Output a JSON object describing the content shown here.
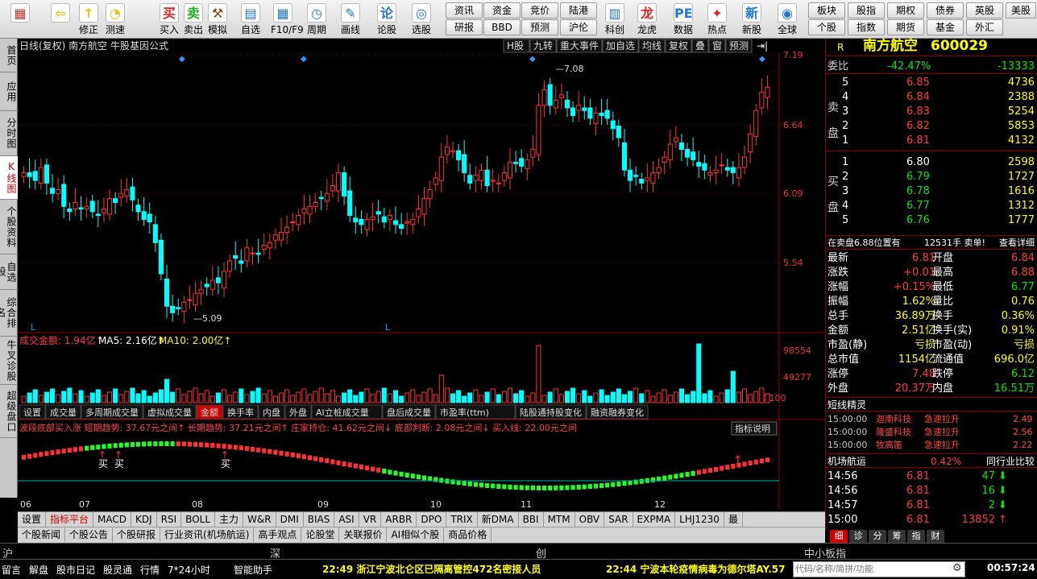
{
  "toolbar": {
    "items": [
      {
        "label": "",
        "icon": "windows-logo-icon"
      },
      {
        "label": "",
        "icon": "back-arrow-icon"
      },
      {
        "label": "修正",
        "icon": "up-arrow-icon"
      },
      {
        "label": "测速",
        "icon": "clock-icon"
      },
      {
        "label": "买入",
        "icon": "buy-icon"
      },
      {
        "label": "卖出",
        "icon": "sell-icon"
      },
      {
        "label": "模拟",
        "icon": "hammer-icon"
      },
      {
        "label": "自选",
        "icon": "watchlist-icon"
      },
      {
        "label": "F10/F9",
        "icon": "f10-icon"
      },
      {
        "label": "周期",
        "icon": "cycle-icon"
      },
      {
        "label": "画线",
        "icon": "pencil-icon"
      },
      {
        "label": "论股",
        "icon": "discuss-icon"
      },
      {
        "label": "选股",
        "icon": "picker-icon"
      },
      {
        "label": "科创",
        "icon": "kechuang-icon"
      },
      {
        "label": "龙虎",
        "icon": "dragon-icon"
      },
      {
        "label": "数据",
        "icon": "pe-icon"
      },
      {
        "label": "热点",
        "icon": "hot-icon"
      },
      {
        "label": "新股",
        "icon": "ipo-icon"
      },
      {
        "label": "全球",
        "icon": "globe-icon"
      }
    ],
    "nav": [
      [
        "资讯",
        "研报"
      ],
      [
        "资金",
        "BBD"
      ],
      [
        "竞价",
        "预测"
      ],
      [
        "陆港",
        "沪伦"
      ]
    ],
    "nav2": [
      [
        "板块",
        "个股"
      ],
      [
        "股指",
        "指数"
      ],
      [
        "期权",
        "期货"
      ],
      [
        "债券",
        "基金"
      ],
      [
        "英股",
        "外汇"
      ],
      [
        "美股",
        ""
      ]
    ]
  },
  "leftnav": [
    "首页",
    "应用",
    "分时图",
    "K线图",
    "个股资料",
    "自选股",
    "综合排名",
    "牛叉诊股",
    "超级盘口"
  ],
  "chart": {
    "header": "日线(复权)  南方航空 牛股基因公式",
    "tabs": [
      "H股",
      "九转",
      "重大事件",
      "加自选",
      "均线",
      "复权",
      "叠",
      "窗",
      "预测"
    ],
    "price_axis": [
      "7.19",
      "6.64",
      "6.09",
      "5.54"
    ],
    "max_label": "7.08",
    "min_label": "5.09",
    "vol_title": "成交金额: 1.94亿↑",
    "vol_ma5": "MA5: 2.16亿↑",
    "vol_ma10": "MA10: 2.00亿↑",
    "vol_axis": [
      "98554",
      "49277",
      "X100"
    ],
    "subtabs": [
      "设置",
      "成交量",
      "多周期成交量",
      "虚拟成交量",
      "金额",
      "换手率",
      "内盘",
      "外盘",
      "AI立桩成交量",
      "盘后成交量",
      "市盈率(ttm)",
      "陆股通持股变化",
      "融资融券变化"
    ],
    "ind_line": "波段底部买入涨 短期趋势: 37.67元之间↑ 长期趋势: 37.21元之间↑ 庄家持仓: 41.62元之间↓ 底部判断: 2.08元之间↓ 买入线: 22.00元之间",
    "ind_btn": "指标说明",
    "buy_label": "买",
    "months": [
      "06",
      "07",
      "08",
      "09",
      "10",
      "11",
      "12"
    ]
  },
  "botbar1": [
    "设置",
    "指标平台",
    "MACD",
    "KDJ",
    "RSI",
    "BOLL",
    "主力",
    "W&R",
    "DMI",
    "BIAS",
    "ASI",
    "VR",
    "ARBR",
    "DPO",
    "TRIX",
    "新DMA",
    "BBI",
    "MTM",
    "OBV",
    "SAR",
    "EXPMA",
    "LHJ1230",
    "最"
  ],
  "botbar2": [
    "个股新闻",
    "个股公告",
    "个股研报",
    "行业资讯(机场航运)",
    "高手观点",
    "论股堂",
    "关联报价",
    "AI相似个股",
    "商品价格"
  ],
  "quote": {
    "name": "南方航空",
    "code": "600029",
    "weibi_label": "委比",
    "weibi": "-42.47%",
    "weicha": "-13333",
    "sell": [
      [
        "5",
        "6.85",
        "4736"
      ],
      [
        "4",
        "6.84",
        "2388"
      ],
      [
        "3",
        "6.83",
        "5254"
      ],
      [
        "2",
        "6.82",
        "5853"
      ],
      [
        "1",
        "6.81",
        "4132"
      ]
    ],
    "buy": [
      [
        "1",
        "6.80",
        "2598"
      ],
      [
        "2",
        "6.79",
        "1727"
      ],
      [
        "3",
        "6.78",
        "1616"
      ],
      [
        "4",
        "6.77",
        "1312"
      ],
      [
        "5",
        "6.76",
        "1777"
      ]
    ],
    "note": "在卖盘6.88位置有",
    "note_vol": "12531手 卖单!",
    "note_link": "查看详细",
    "stats": [
      [
        "最新",
        "6.81",
        "开盘",
        "6.84"
      ],
      [
        "涨跌",
        "+0.01",
        "最高",
        "6.88"
      ],
      [
        "涨幅",
        "+0.15%",
        "最低",
        "6.77"
      ],
      [
        "振幅",
        "1.62%",
        "量比",
        "0.76"
      ],
      [
        "总手",
        "36.89万",
        "换手",
        "0.36%"
      ],
      [
        "金额",
        "2.51亿",
        "换手(实)",
        "0.91%"
      ],
      [
        "市盈(静)",
        "亏损",
        "市盈(动)",
        "亏损"
      ],
      [
        "总市值",
        "1154亿",
        "流通值",
        "696.0亿"
      ],
      [
        "涨停",
        "7.48",
        "跌停",
        "6.12"
      ],
      [
        "外盘",
        "20.37万",
        "内盘",
        "16.51万"
      ]
    ],
    "short_title": "短线精灵",
    "short": [
      [
        "15:00:00",
        "迦南科技",
        "急速拉升",
        "2.49"
      ],
      [
        "15:00:00",
        "隆盛科技",
        "急速拉升",
        "2.56"
      ],
      [
        "15:00:00",
        "牧高笛",
        "急速拉升",
        "2.22"
      ]
    ],
    "sector": "机场航运",
    "sector_pct": "0.42%",
    "sector_btn": "同行业比较",
    "ticks": [
      [
        "14:56",
        "6.81",
        "47"
      ],
      [
        "14:56",
        "6.81",
        "16"
      ],
      [
        "14:57",
        "6.81",
        "2"
      ],
      [
        "15:00",
        "6.81",
        "13852"
      ]
    ],
    "tabs": [
      "细",
      "诊",
      "分",
      "筹",
      "指",
      "财"
    ]
  },
  "status": {
    "sh": "沪",
    "sz": "深",
    "cy": "创",
    "zx": "中小板指"
  },
  "ticker": {
    "items": [
      "留言",
      "解盘",
      "股市日记",
      "股灵通",
      "行情",
      "7*24小时",
      "智能助手"
    ],
    "news1": "22:49 浙江宁波北仑区已隔离管控472名密接人员",
    "news2": "22:44 宁波本轮疫情病毒为德尔塔AY.57",
    "search": "代码/名称/简拼/功能",
    "time": "00:57:24"
  }
}
